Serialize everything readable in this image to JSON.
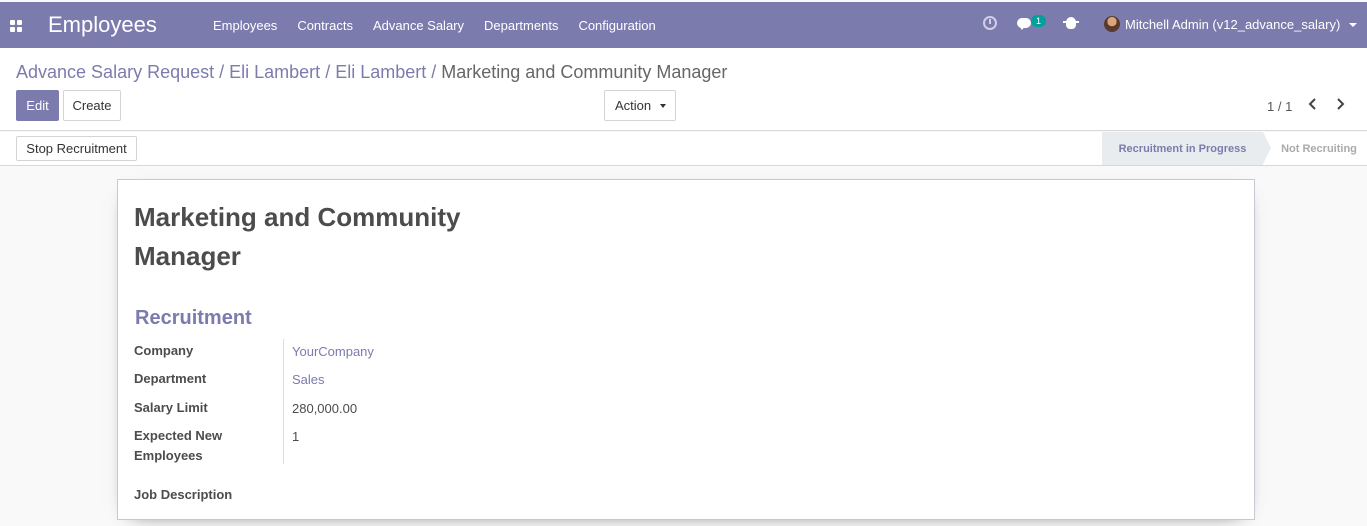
{
  "navbar": {
    "app_title": "Employees",
    "menu": [
      "Employees",
      "Contracts",
      "Advance Salary",
      "Departments",
      "Configuration"
    ],
    "chat_badge": "1",
    "user": "Mitchell Admin (v12_advance_salary)"
  },
  "breadcrumb": {
    "items": [
      "Advance Salary Request",
      "Eli Lambert",
      "Eli Lambert"
    ],
    "active": "Marketing and Community Manager"
  },
  "buttons": {
    "edit": "Edit",
    "create": "Create",
    "action": "Action",
    "stop_recruitment": "Stop Recruitment"
  },
  "pager": {
    "value": "1 / 1"
  },
  "status": {
    "active_stage": "Recruitment in Progress",
    "inactive_stage": "Not Recruiting"
  },
  "form": {
    "job_title": "Marketing and Community Manager",
    "section_title": "Recruitment",
    "fields": [
      {
        "label": "Company",
        "value": "YourCompany"
      },
      {
        "label": "Department",
        "value": "Sales"
      },
      {
        "label": "Salary Limit",
        "value": "280,000.00"
      },
      {
        "label": "Expected New Employees",
        "value": "1"
      }
    ],
    "job_description_label": "Job Description"
  },
  "colors": {
    "brand": "#7c7bad",
    "badge": "#00a09d"
  }
}
